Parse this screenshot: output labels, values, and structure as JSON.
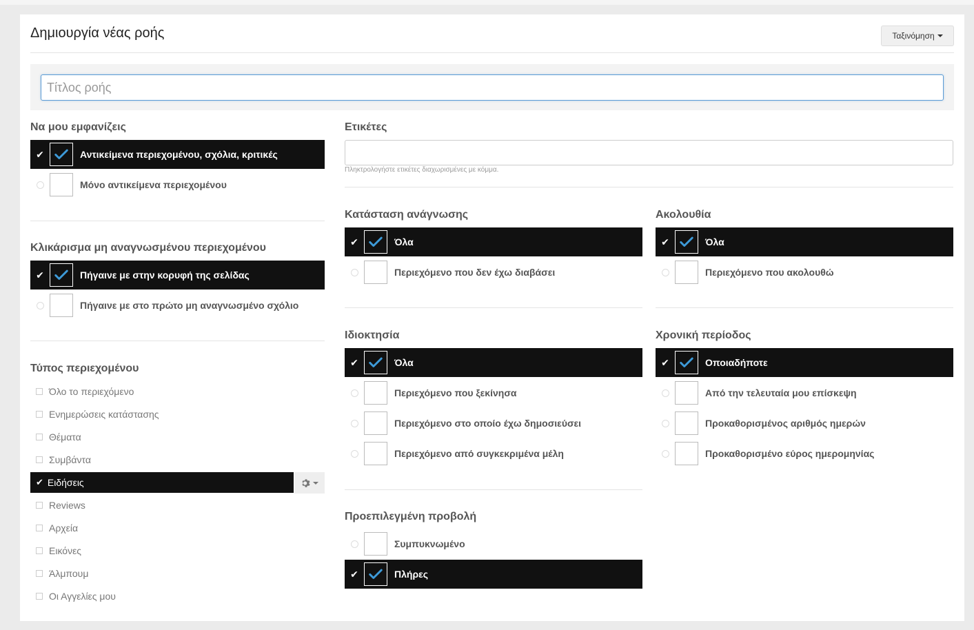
{
  "page": {
    "title": "Δημιουργία νέας ροής",
    "sort_label": "Ταξινόμηση"
  },
  "stream_title": {
    "placeholder": "Τίτλος ροής"
  },
  "show_me": {
    "title": "Να μου εμφανίζεις",
    "options": [
      "Αντικείμενα περιεχομένου, σχόλια, κριτικές",
      "Μόνο αντικείμενα περιεχομένου"
    ],
    "selected": 0
  },
  "click_unread": {
    "title": "Κλικάρισμα μη αναγνωσμένου περιεχομένου",
    "options": [
      "Πήγαινε με στην κορυφή της σελίδας",
      "Πήγαινε με στο πρώτο μη αναγνωσμένο σχόλιο"
    ],
    "selected": 0
  },
  "content_type": {
    "title": "Τύπος περιεχομένου",
    "items": [
      "Όλο το περιεχόμενο",
      "Ενημερώσεις κατάστασης",
      "Θέματα",
      "Συμβάντα",
      "Ειδήσεις",
      "Reviews",
      "Αρχεία",
      "Εικόνες",
      "Άλμπουμ",
      "Οι Αγγελίες μου"
    ],
    "selected": 4
  },
  "tags": {
    "title": "Ετικέτες",
    "value": "",
    "hint": "Πληκτρολογήστε ετικέτες διαχωρισμένες με κόμμα."
  },
  "read_status": {
    "title": "Κατάσταση ανάγνωσης",
    "options": [
      "Όλα",
      "Περιεχόμενο που δεν έχω διαβάσει"
    ],
    "selected": 0
  },
  "follow": {
    "title": "Ακολουθία",
    "options": [
      "Όλα",
      "Περιεχόμενο που ακολουθώ"
    ],
    "selected": 0
  },
  "ownership": {
    "title": "Ιδιοκτησία",
    "options": [
      "Όλα",
      "Περιεχόμενο που ξεκίνησα",
      "Περιεχόμενο στο οποίο έχω δημοσιεύσει",
      "Περιεχόμενο από συγκεκριμένα μέλη"
    ],
    "selected": 0
  },
  "time_period": {
    "title": "Χρονική περίοδος",
    "options": [
      "Οποιαδήποτε",
      "Από την τελευταία μου επίσκεψη",
      "Προκαθορισμένος αριθμός ημερών",
      "Προκαθορισμένο εύρος ημερομηνίας"
    ],
    "selected": 0
  },
  "default_view": {
    "title": "Προεπιλεγμένη προβολή",
    "options": [
      "Συμπυκνωμένο",
      "Πλήρες"
    ],
    "selected": 1
  },
  "colors": {
    "accent": "#3d9ad8",
    "selected_bg": "#111111"
  }
}
